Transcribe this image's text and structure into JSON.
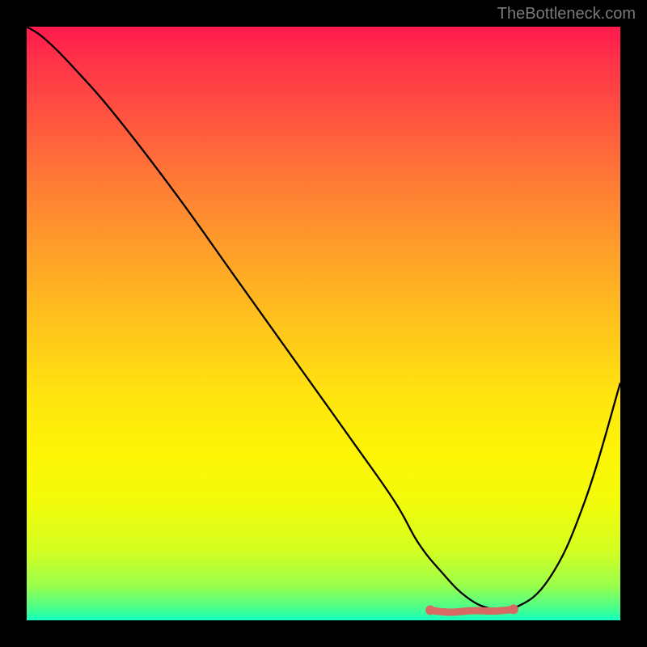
{
  "watermark": "TheBottleneck.com",
  "chart_data": {
    "type": "line",
    "title": "",
    "xlabel": "",
    "ylabel": "",
    "xlim": [
      0,
      100
    ],
    "ylim": [
      0,
      100
    ],
    "series": [
      {
        "name": "bottleneck-curve",
        "x": [
          0,
          3,
          8,
          15,
          25,
          35,
          45,
          55,
          62,
          66,
          70,
          74,
          78,
          82,
          88,
          94,
          100
        ],
        "y": [
          100,
          98,
          93,
          85,
          72,
          58,
          44,
          30,
          20,
          13,
          8,
          4,
          2,
          2,
          7,
          20,
          40
        ]
      }
    ],
    "markers": {
      "optimal_range_x": [
        68,
        82
      ],
      "optimal_y": 2,
      "dots_x": [
        68,
        82
      ]
    },
    "colors": {
      "curve": "#000000",
      "marker": "#d86a63",
      "gradient_top": "#ff1a4d",
      "gradient_bottom": "#14ffbf"
    }
  }
}
